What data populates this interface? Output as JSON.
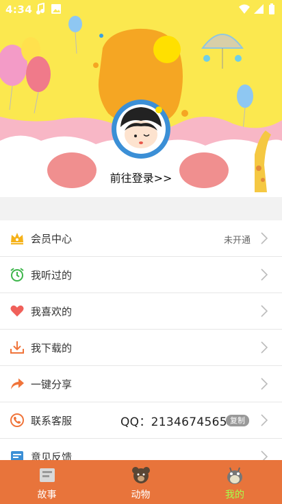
{
  "status_bar": {
    "time": "4:34"
  },
  "header": {
    "login_link": "前往登录>>"
  },
  "menu": {
    "items": [
      {
        "label": "会员中心",
        "value": "未开通"
      },
      {
        "label": "我听过的"
      },
      {
        "label": "我喜欢的"
      },
      {
        "label": "我下载的"
      },
      {
        "label": "一键分享"
      },
      {
        "label": "联系客服",
        "qq": "QQ：2134674565",
        "copy_label": "复制"
      },
      {
        "label": "意见反馈"
      }
    ]
  },
  "tabs": [
    {
      "label": "故事",
      "active": false
    },
    {
      "label": "动物",
      "active": false
    },
    {
      "label": "我的",
      "active": true
    }
  ],
  "colors": {
    "tabbar": "#e8743b",
    "active_tab": "#a6ff4d",
    "header_yellow": "#fbe84f"
  }
}
